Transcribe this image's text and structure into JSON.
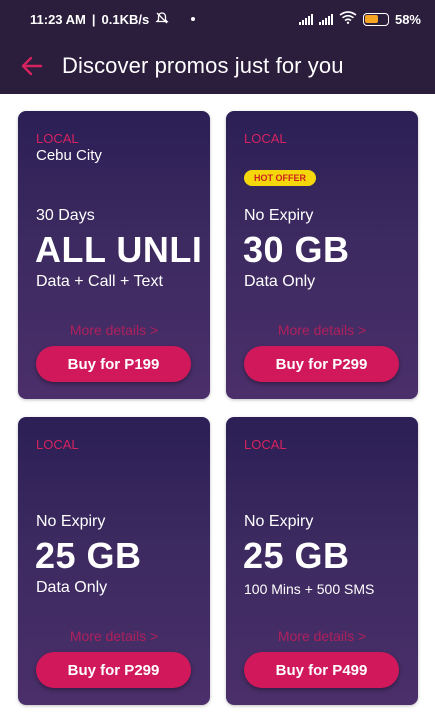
{
  "status_bar": {
    "time": "11:23 AM",
    "speed": "0.1KB/s",
    "battery": "58%",
    "battery_level": 0.58,
    "icons": [
      "mute-alarm-icon",
      "signal-icon",
      "signal-icon",
      "wifi-icon",
      "battery-icon"
    ]
  },
  "header": {
    "title": "Discover promos just for you",
    "back_icon": "arrow-left-icon",
    "accent_color": "#d6225f",
    "background": "#2b1d3c"
  },
  "promos": [
    {
      "tag": "LOCAL",
      "city": "Cebu City",
      "badge": "",
      "validity": "30 Days",
      "headline": "ALL UNLI",
      "description": "Data + Call + Text",
      "more": "More details >",
      "button": "Buy for P199"
    },
    {
      "tag": "LOCAL",
      "city": "",
      "badge": "HOT OFFER",
      "validity": "No Expiry",
      "headline": "30 GB",
      "description": "Data Only",
      "more": "More details >",
      "button": "Buy for P299"
    },
    {
      "tag": "LOCAL",
      "city": "",
      "badge": "",
      "validity": "No Expiry",
      "headline": "25 GB",
      "description": "Data Only",
      "more": "More details >",
      "button": "Buy for P299"
    },
    {
      "tag": "LOCAL",
      "city": "",
      "badge": "",
      "validity": "No Expiry",
      "headline": "25 GB",
      "description": "100 Mins + 500 SMS",
      "more": "More details >",
      "button": "Buy for P499"
    }
  ],
  "colors": {
    "card_gradient_top": "#2b1f55",
    "card_gradient_bottom": "#4b2f6a",
    "button": "#d1185a",
    "badge_bg": "#f5d80c",
    "badge_text": "#cc2020"
  }
}
